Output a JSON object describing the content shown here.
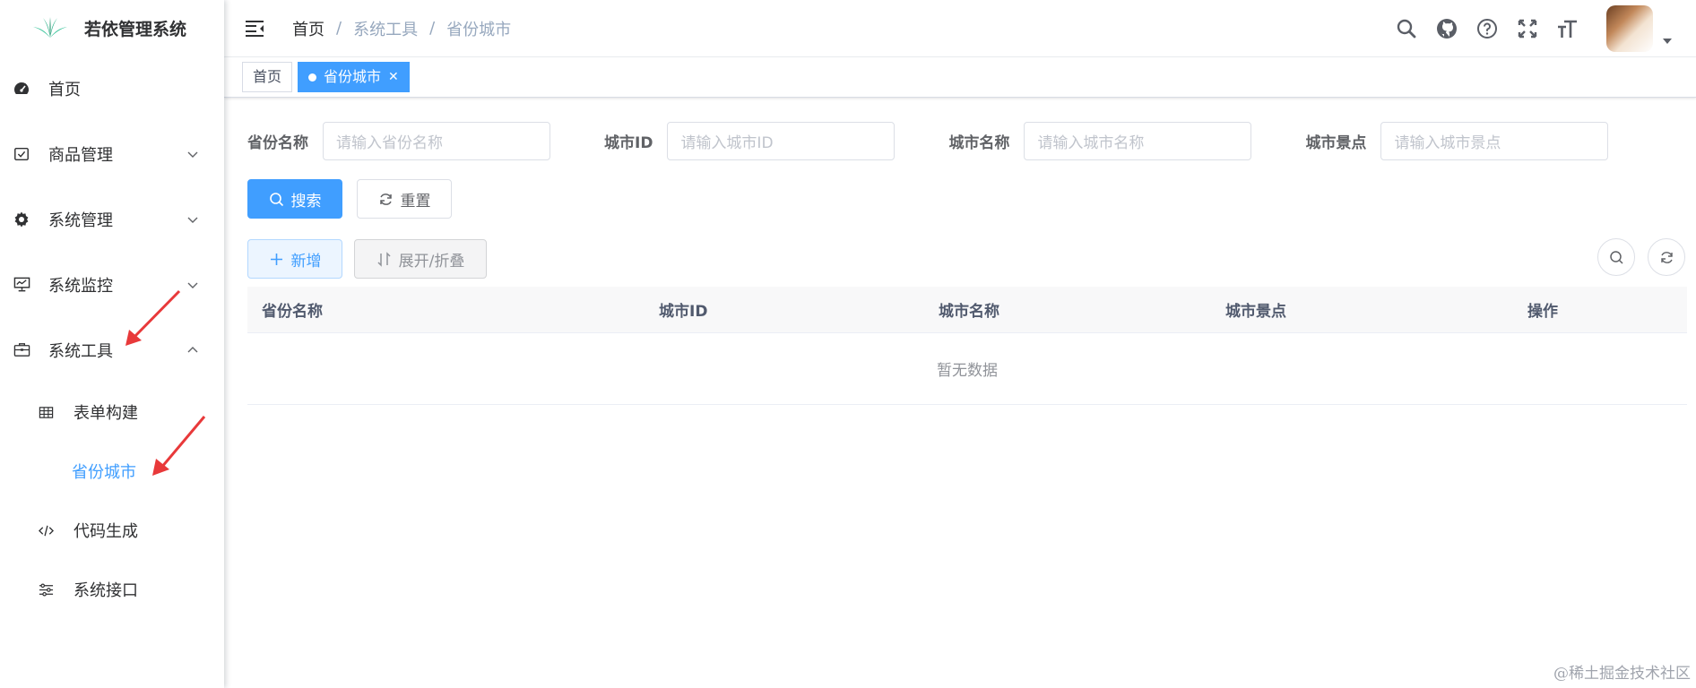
{
  "app": {
    "title": "若依管理系统"
  },
  "sidebar": {
    "items": [
      {
        "label": "首页",
        "icon": "dashboard-icon"
      },
      {
        "label": "商品管理",
        "icon": "checkbox-icon"
      },
      {
        "label": "系统管理",
        "icon": "gear-icon"
      },
      {
        "label": "系统监控",
        "icon": "monitor-icon"
      },
      {
        "label": "系统工具",
        "icon": "toolbox-icon"
      }
    ],
    "sub_items": [
      {
        "label": "表单构建",
        "icon": "table-icon"
      },
      {
        "label": "省份城市",
        "icon": "",
        "active": true
      },
      {
        "label": "代码生成",
        "icon": "code-icon"
      },
      {
        "label": "系统接口",
        "icon": "sliders-icon"
      }
    ]
  },
  "breadcrumb": {
    "items": [
      "首页",
      "系统工具",
      "省份城市"
    ],
    "separator": "/"
  },
  "tags": {
    "home": "首页",
    "active": "省份城市"
  },
  "search_form": {
    "fields": [
      {
        "label": "省份名称",
        "placeholder": "请输入省份名称"
      },
      {
        "label": "城市ID",
        "placeholder": "请输入城市ID"
      },
      {
        "label": "城市名称",
        "placeholder": "请输入城市名称"
      },
      {
        "label": "城市景点",
        "placeholder": "请输入城市景点"
      }
    ],
    "search_label": "搜索",
    "reset_label": "重置"
  },
  "toolbar": {
    "add_label": "新增",
    "expand_label": "展开/折叠"
  },
  "table": {
    "columns": [
      "省份名称",
      "城市ID",
      "城市名称",
      "城市景点",
      "操作"
    ],
    "empty_text": "暂无数据"
  },
  "watermark": "@稀土掘金技术社区",
  "colors": {
    "primary": "#409eff",
    "annotation_arrow": "#e8393a"
  }
}
